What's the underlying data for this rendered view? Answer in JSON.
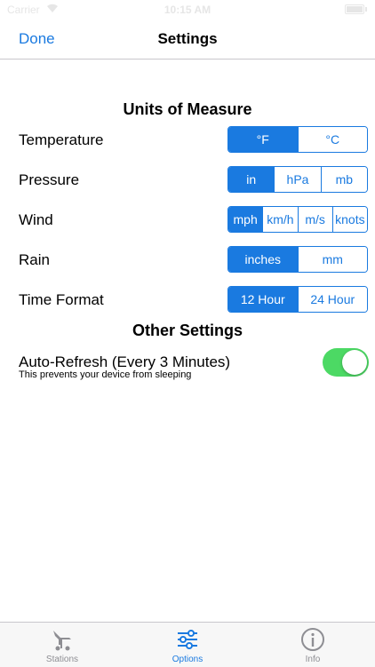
{
  "status_bar": {
    "carrier": "Carrier",
    "time": "10:15 AM"
  },
  "nav": {
    "done_label": "Done",
    "title": "Settings"
  },
  "units_section": {
    "title": "Units of Measure"
  },
  "rows": {
    "temperature": {
      "label": "Temperature",
      "options": [
        "°F",
        "°C"
      ],
      "selected": "°F"
    },
    "pressure": {
      "label": "Pressure",
      "options": [
        "in",
        "hPa",
        "mb"
      ],
      "selected": "in"
    },
    "wind": {
      "label": "Wind",
      "options": [
        "mph",
        "km/h",
        "m/s",
        "knots"
      ],
      "selected": "mph"
    },
    "rain": {
      "label": "Rain",
      "options": [
        "inches",
        "mm"
      ],
      "selected": "inches"
    },
    "time_format": {
      "label": "Time Format",
      "options": [
        "12 Hour",
        "24 Hour"
      ],
      "selected": "12 Hour"
    }
  },
  "other_section": {
    "title": "Other Settings"
  },
  "auto_refresh": {
    "label": "Auto-Refresh (Every 3 Minutes)",
    "sublabel": "This prevents your device from sleeping",
    "enabled": true
  },
  "tabs": [
    {
      "label": "Stations",
      "icon": "stations-icon",
      "active": false
    },
    {
      "label": "Options",
      "icon": "sliders-icon",
      "active": true
    },
    {
      "label": "Info",
      "icon": "info-icon",
      "active": false
    }
  ],
  "colors": {
    "accent": "#1a7ae0",
    "toggle_on": "#4cd964",
    "inactive_tab": "#8e8e93"
  }
}
